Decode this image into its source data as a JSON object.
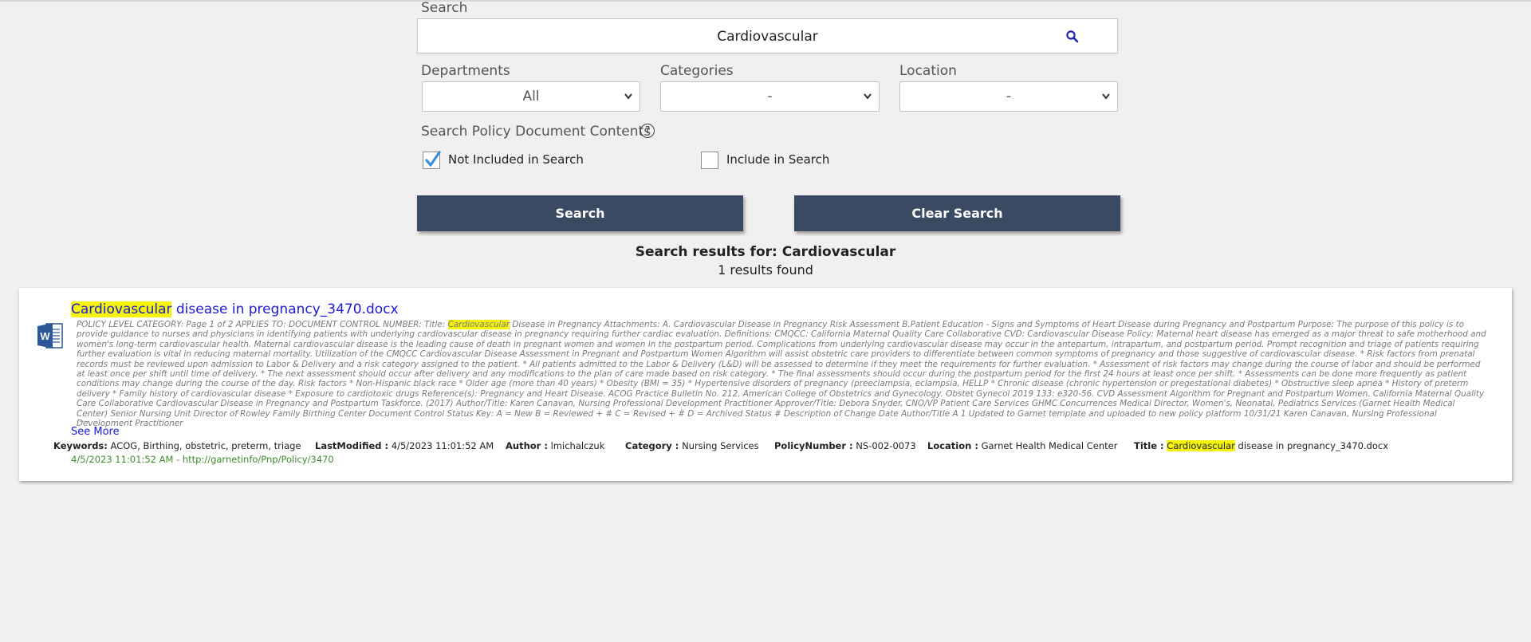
{
  "search": {
    "label": "Search",
    "value": "Cardiovascular"
  },
  "filters": {
    "departments": {
      "label": "Departments",
      "value": "All"
    },
    "categories": {
      "label": "Categories",
      "value": "-"
    },
    "location": {
      "label": "Location",
      "value": "-"
    }
  },
  "contents": {
    "label": "Search Policy Document Contents",
    "info_symbol": "?",
    "not_included_label": "Not Included in Search",
    "not_included_checked": true,
    "include_label": "Include in Search",
    "include_checked": false
  },
  "buttons": {
    "search": "Search",
    "clear": "Clear Search"
  },
  "results": {
    "heading_prefix": "Search results for: ",
    "term": "Cardiovascular",
    "count": "1 results found"
  },
  "result": {
    "icon": "word-doc-icon",
    "title_highlight": "Cardiovascular",
    "title_rest": " disease in pregnancy_3470.docx",
    "snippet_prefix": "POLICY LEVEL CATEGORY: Page 1 of 2 APPLIES TO: DOCUMENT CONTROL NUMBER: Title: ",
    "snippet_highlight": "Cardiovascular",
    "snippet_rest": " Disease in Pregnancy Attachments: A. Cardiovascular Disease in Pregnancy Risk Assessment B.Patient Education - Signs and Symptoms of Heart Disease during Pregnancy and Postpartum Purpose: The purpose of this policy is to provide guidance to nurses and physicians in identifying patients with underlying cardiovascular disease in pregnancy requiring further cardiac evaluation. Definitions: CMQCC: California Maternal Quality Care Collaborative CVD: Cardiovascular Disease Policy: Maternal heart disease has emerged as a major threat to safe motherhood and women's long-term cardiovascular health. Maternal cardiovascular disease is the leading cause of death in pregnant women and women in the postpartum period. Complications from underlying cardiovascular disease may occur in the antepartum, intrapartum, and postpartum period. Prompt recognition and triage of patients requiring further evaluation is vital in reducing maternal mortality. Utilization of the CMQCC Cardiovascular Disease Assessment in Pregnant and Postpartum Women Algorithm will assist obstetric care providers to differentiate between common symptoms of pregnancy and those suggestive of cardiovascular disease. * Risk factors from prenatal records must be reviewed upon admission to Labor & Delivery and a risk category assigned to the patient. * All patients admitted to the Labor & Delivery (L&D) will be assessed to determine if they meet the requirements for further evaluation. * Assessment of risk factors may change during the course of labor and should be performed at least once per shift until time of delivery. * The next assessment should occur after delivery and any modifications to the plan of care made based on risk category. * The final assessments should occur during the postpartum period for the first 24 hours at least once per shift. * Assessments can be done more frequently as patient conditions may change during the course of the day. Risk factors * Non-Hispanic black race * Older age (more than 40 years) * Obesity (BMI = 35) * Hypertensive disorders of pregnancy (preeclampsia, eclampsia, HELLP * Chronic disease (chronic hypertension or pregestational diabetes) * Obstructive sleep apnea * History of preterm delivery * Family history of cardiovascular disease * Exposure to cardiotoxic drugs Reference(s): Pregnancy and Heart Disease. ACOG Practice Bulletin No. 212. American College of Obstetrics and Gynecology. Obstet Gynecol 2019 133: e320-56. CVD Assessment Algorithm for Pregnant and Postpartum Women. California Maternal Quality Care Collaborative Cardiovascular Disease in Pregnancy and Postpartum Taskforce. (2017) Author/Title: Karen Canavan, Nursing Professional Development Practitioner Approver/Title: Debora Snyder, CNO/VP Patient Care Services GHMC Concurrences Medical Director, Women's, Neonatal, Pediatrics Services (Garnet Health Medical Center) Senior Nursing Unit Director of Rowley Family Birthing Center Document Control Status Key: A = New B = Reviewed + # C = Revised + # D = Archived Status # Description of Change Date Author/Title A 1 Updated to Garnet template and uploaded to new policy platform 10/31/21 Karen Canavan, Nursing Professional Development Practitioner",
    "ellipsis": ".....",
    "see_more": "See More",
    "keywords_label": "Keywords:",
    "keywords": "ACOG, Birthing, obstetric, preterm, triage",
    "modified_label": "LastModified :",
    "modified": "4/5/2023 11:01:52 AM",
    "author_label": "Author :",
    "author": "lmichalczuk",
    "category_label": "Category :",
    "category": "Nursing Services",
    "policy_label": "PolicyNumber :",
    "policy": "NS-002-0073",
    "location_label": "Location :",
    "location": "Garnet Health Medical Center",
    "meta_title_label": "Title :",
    "meta_title_highlight": "Cardiovascular",
    "meta_title_rest": " disease in pregnancy_3470.docx",
    "url_line": "4/5/2023 11:01:52 AM - http://garnetinfo/Pnp/Policy/3470"
  },
  "colors": {
    "button_bg": "#3b4a63",
    "link": "#1a1ad6",
    "highlight": "#f5f30a",
    "url_green": "#3c8c2c",
    "checkbox_check": "#3b8fd8"
  }
}
